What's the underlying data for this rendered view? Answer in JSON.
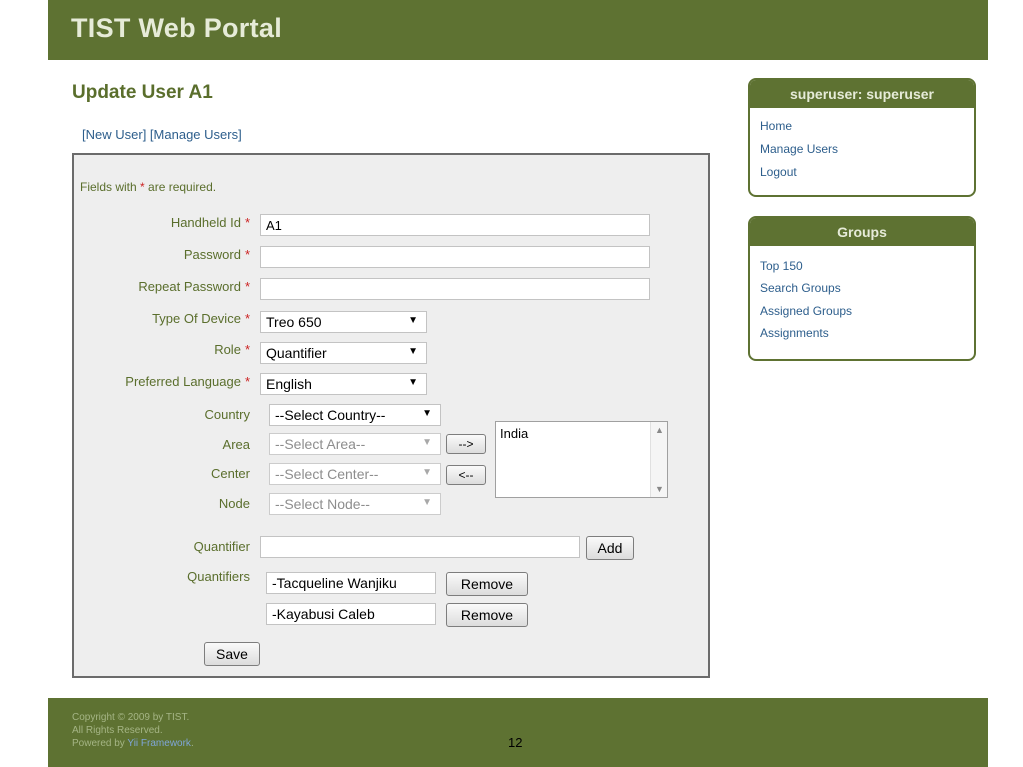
{
  "header": {
    "logo": "TIST Web Portal"
  },
  "main": {
    "title": "Update User A1",
    "links": {
      "open": "[",
      "new_user": "New User",
      "mid": "] [",
      "manage_users": "Manage Users",
      "close": "]"
    },
    "required_note": {
      "prefix": "Fields with ",
      "star": "*",
      "suffix": " are required."
    }
  },
  "form": {
    "required_star": "*",
    "handheld_id": {
      "label": "Handheld Id",
      "value": "A1"
    },
    "password": {
      "label": "Password",
      "value": ""
    },
    "repeat_password": {
      "label": "Repeat Password",
      "value": ""
    },
    "type_of_device": {
      "label": "Type Of Device",
      "value": "Treo 650"
    },
    "role": {
      "label": "Role",
      "value": "Quantifier"
    },
    "preferred_language": {
      "label": "Preferred Language",
      "value": "English"
    },
    "country": {
      "label": "Country",
      "value": "--Select Country--"
    },
    "area": {
      "label": "Area",
      "value": "--Select Area--"
    },
    "center": {
      "label": "Center",
      "value": "--Select Center--"
    },
    "node": {
      "label": "Node",
      "value": "--Select Node--"
    },
    "move_right_label": "-->",
    "move_left_label": "<--",
    "assigned_list": [
      "India"
    ],
    "quantifier": {
      "label": "Quantifier",
      "value": ""
    },
    "add_label": "Add",
    "quantifiers_label": "Quantifiers",
    "quantifiers": [
      {
        "name": "-Tacqueline Wanjiku",
        "remove_label": "Remove"
      },
      {
        "name": "-Kayabusi Caleb",
        "remove_label": "Remove"
      }
    ],
    "save_label": "Save"
  },
  "sidebar": {
    "user_box": {
      "title": "superuser: superuser",
      "items": [
        "Home",
        "Manage Users",
        "Logout"
      ]
    },
    "groups_box": {
      "title": "Groups",
      "items": [
        "Top 150",
        "Search Groups",
        "Assigned Groups",
        "Assignments"
      ]
    }
  },
  "footer": {
    "copyright": "Copyright © 2009 by TIST.",
    "rights": "All Rights Reserved.",
    "powered_prefix": "Powered by ",
    "powered_link": "Yii Framework",
    "powered_suffix": ".",
    "page_number": "12"
  },
  "colors": {
    "brand": "#5e7232",
    "label": "#5a6e2c",
    "link": "#2d5e8c",
    "required": "#cc2222"
  }
}
